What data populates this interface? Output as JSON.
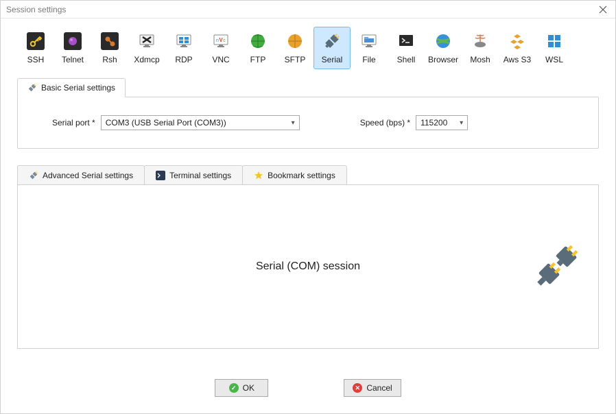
{
  "window": {
    "title": "Session settings"
  },
  "sessionTypes": [
    {
      "label": "SSH"
    },
    {
      "label": "Telnet"
    },
    {
      "label": "Rsh"
    },
    {
      "label": "Xdmcp"
    },
    {
      "label": "RDP"
    },
    {
      "label": "VNC"
    },
    {
      "label": "FTP"
    },
    {
      "label": "SFTP"
    },
    {
      "label": "Serial",
      "selected": true
    },
    {
      "label": "File"
    },
    {
      "label": "Shell"
    },
    {
      "label": "Browser"
    },
    {
      "label": "Mosh"
    },
    {
      "label": "Aws S3"
    },
    {
      "label": "WSL"
    }
  ],
  "basic": {
    "tabLabel": "Basic Serial settings",
    "portLabel": "Serial port *",
    "portValue": "COM3  (USB Serial Port (COM3))",
    "speedLabel": "Speed (bps) *",
    "speedValue": "115200"
  },
  "advancedTabs": {
    "advSerial": "Advanced Serial settings",
    "terminal": "Terminal settings",
    "bookmark": "Bookmark settings"
  },
  "panel": {
    "label": "Serial (COM) session"
  },
  "buttons": {
    "ok": "OK",
    "cancel": "Cancel"
  }
}
